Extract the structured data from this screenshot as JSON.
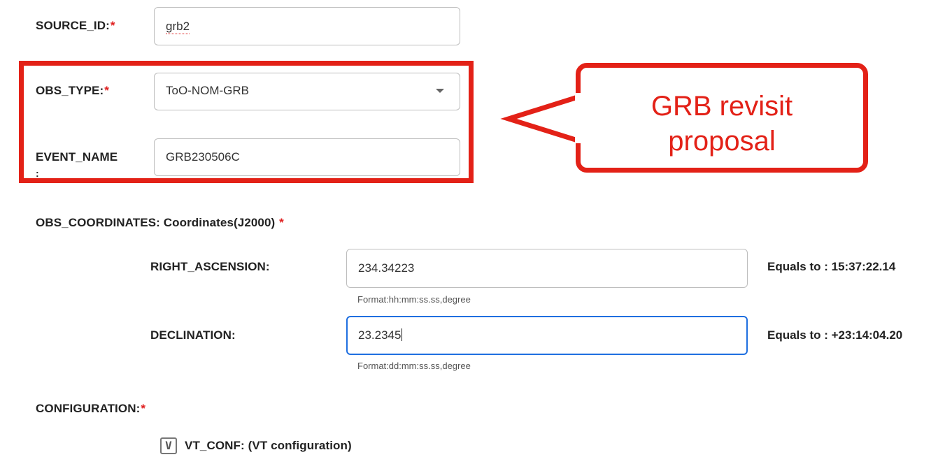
{
  "source_id": {
    "label": "SOURCE_ID:",
    "required_mark": "*",
    "value": "grb2"
  },
  "obs_type": {
    "label": "OBS_TYPE:",
    "required_mark": "*",
    "selected": "ToO-NOM-GRB"
  },
  "event_name": {
    "label": "EVENT_NAME",
    "label_overflow": ":",
    "value": "GRB230506C"
  },
  "callout": {
    "line1": "GRB revisit",
    "line2": "proposal",
    "color": "#e32117"
  },
  "obs_coordinates": {
    "heading": "OBS_COORDINATES: Coordinates(J2000)",
    "required_mark": "*",
    "right_ascension": {
      "label": "RIGHT_ASCENSION:",
      "value": "234.34223",
      "hint": "Format:hh:mm:ss.ss,degree",
      "equals": "Equals to : 15:37:22.14"
    },
    "declination": {
      "label": "DECLINATION:",
      "value": "23.2345",
      "hint": "Format:dd:mm:ss.ss,degree",
      "equals": "Equals to : +23:14:04.20"
    }
  },
  "configuration": {
    "label": "CONFIGURATION:",
    "required_mark": "*",
    "vt_conf": {
      "icon": "V",
      "label": "VT_CONF: (VT configuration)"
    }
  },
  "colors": {
    "required": "#e02020",
    "highlight": "#e32117",
    "focus": "#1f6fe0"
  }
}
